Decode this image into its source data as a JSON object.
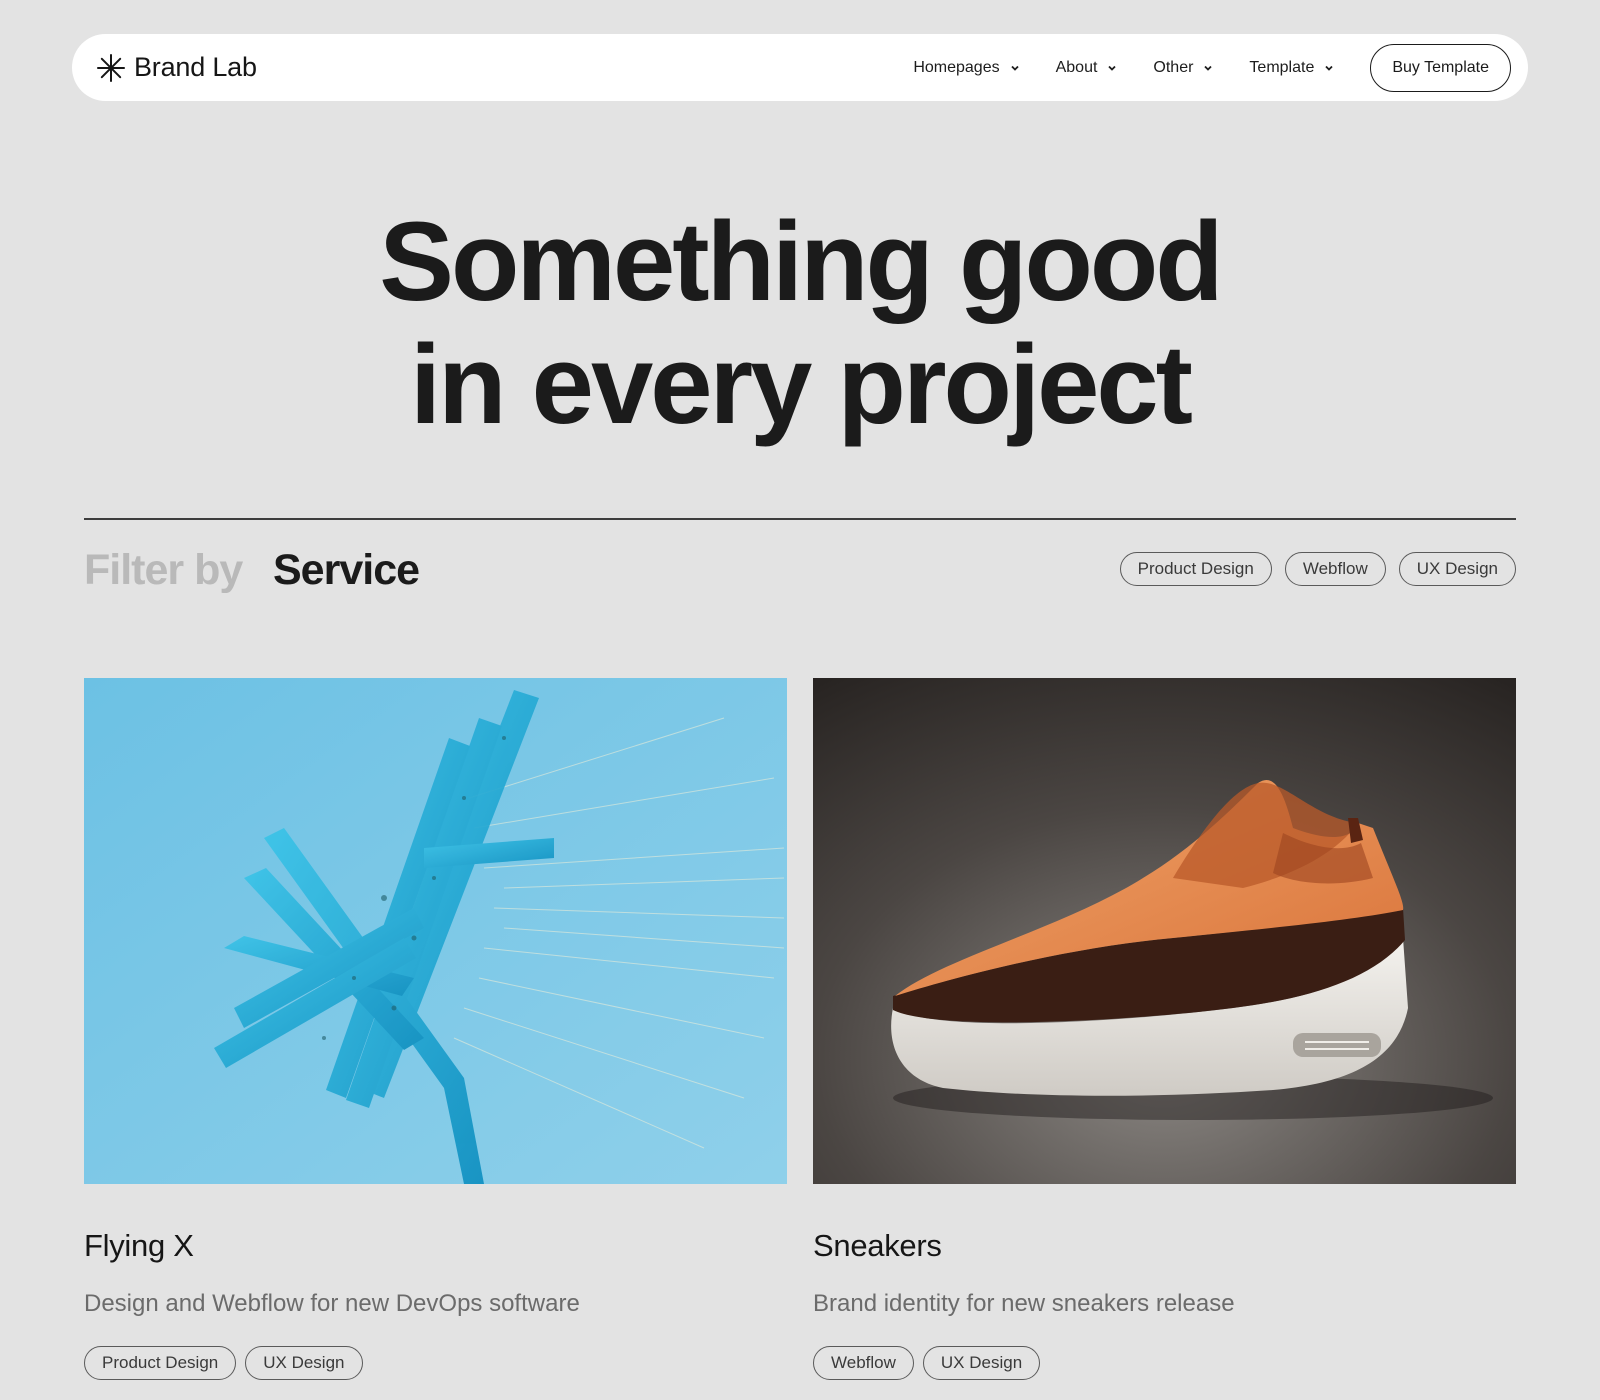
{
  "nav": {
    "brand": "Brand Lab",
    "items": [
      {
        "label": "Homepages"
      },
      {
        "label": "About"
      },
      {
        "label": "Other"
      },
      {
        "label": "Template"
      }
    ],
    "cta": "Buy Template"
  },
  "hero": {
    "line1": "Something good",
    "line2": "in every project"
  },
  "filter": {
    "label": "Filter by",
    "value": "Service",
    "tags": [
      "Product Design",
      "Webflow",
      "UX Design"
    ]
  },
  "projects": [
    {
      "title": "Flying X",
      "description": "Design and Webflow for new DevOps software",
      "tags": [
        "Product Design",
        "UX Design"
      ],
      "image": "abstract-blue-x-sculpture"
    },
    {
      "title": "Sneakers",
      "description": "Brand identity for new sneakers release",
      "tags": [
        "Webflow",
        "UX Design"
      ],
      "image": "orange-sneaker"
    }
  ],
  "colors": {
    "background": "#e3e3e3",
    "text": "#1b1b1b",
    "muted": "#b9b9b9",
    "card1_bg": "#7ec7e2",
    "card2_bg": "#2a2625",
    "shoe_orange": "#e38a4f"
  }
}
